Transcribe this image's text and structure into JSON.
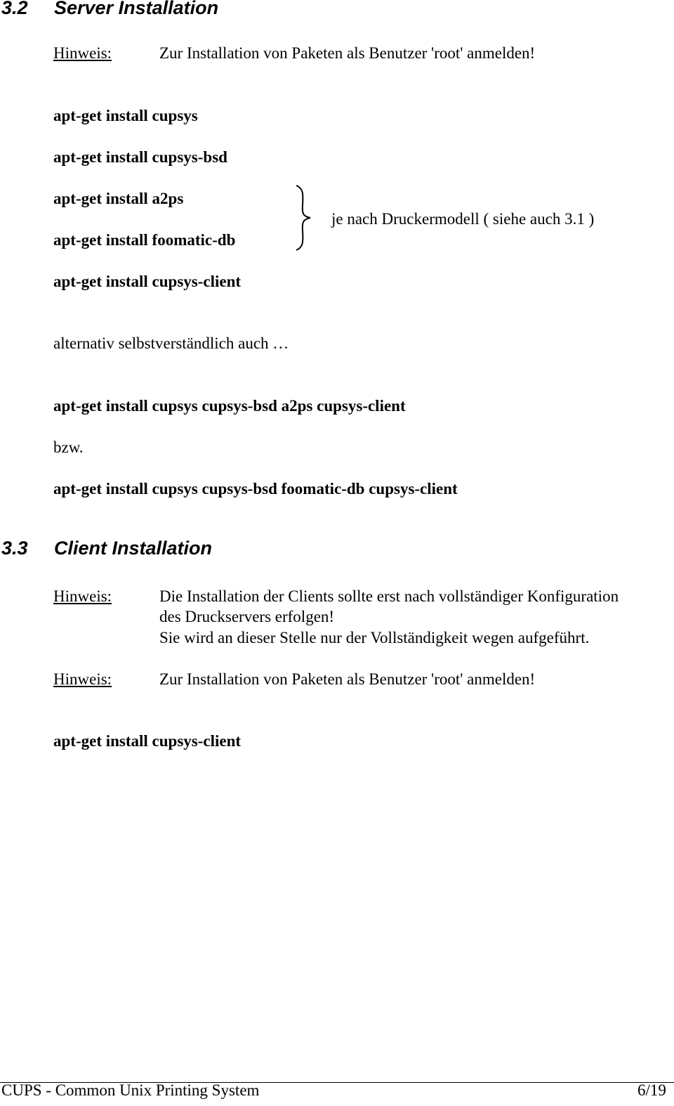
{
  "section_32": {
    "number": "3.2",
    "title": "Server Installation",
    "note_label": "Hinweis:",
    "note_text": "Zur Installation von Paketen als Benutzer 'root' anmelden!",
    "commands": [
      "apt-get install cupsys",
      "apt-get install cupsys-bsd",
      "apt-get install a2ps",
      "apt-get install foomatic-db",
      "apt-get install cupsys-client"
    ],
    "brace_note": "je nach Druckermodell ( siehe auch 3.1 )",
    "alternative_text": "alternativ selbstverständlich auch …",
    "combined_command_1": "apt-get install cupsys cupsys-bsd a2ps cupsys-client",
    "or_text": "bzw.",
    "combined_command_2": "apt-get install cupsys cupsys-bsd foomatic-db cupsys-client"
  },
  "section_33": {
    "number": "3.3",
    "title": "Client Installation",
    "note1_label": "Hinweis:",
    "note1_lines": [
      "Die Installation der Clients sollte erst nach vollständiger Konfiguration",
      "des Druckservers erfolgen!",
      "Sie wird an dieser Stelle nur der Vollständigkeit wegen aufgeführt."
    ],
    "note2_label": "Hinweis:",
    "note2_text": "Zur Installation von Paketen als Benutzer 'root' anmelden!",
    "command": "apt-get install cupsys-client"
  },
  "footer": {
    "title": "CUPS - Common Unix Printing System",
    "page": "6/19"
  }
}
